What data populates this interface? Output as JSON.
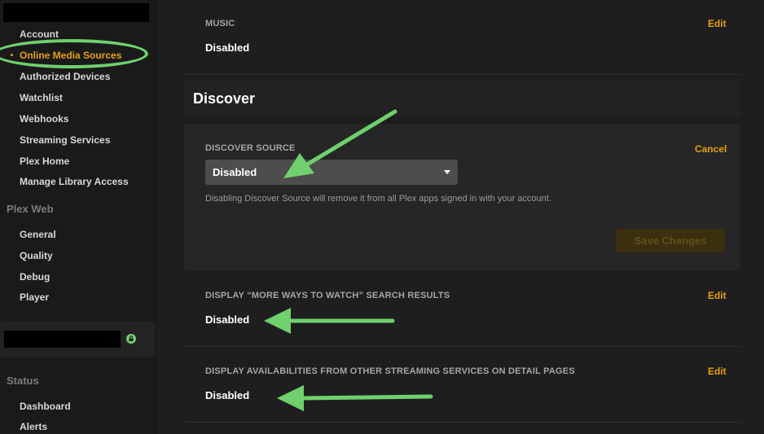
{
  "sidebar": {
    "account_items": [
      {
        "label": "Account"
      },
      {
        "label": "Online Media Sources"
      },
      {
        "label": "Authorized Devices"
      },
      {
        "label": "Watchlist"
      },
      {
        "label": "Webhooks"
      },
      {
        "label": "Streaming Services"
      },
      {
        "label": "Plex Home"
      },
      {
        "label": "Manage Library Access"
      }
    ],
    "plex_web_heading": "Plex Web",
    "plex_web_items": [
      {
        "label": "General"
      },
      {
        "label": "Quality"
      },
      {
        "label": "Debug"
      },
      {
        "label": "Player"
      }
    ],
    "status_heading": "Status",
    "status_items": [
      {
        "label": "Dashboard"
      },
      {
        "label": "Alerts"
      }
    ]
  },
  "main": {
    "music": {
      "label": "MUSIC",
      "value": "Disabled",
      "action": "Edit"
    },
    "discover": {
      "title": "Discover",
      "source_label": "DISCOVER SOURCE",
      "source_value": "Disabled",
      "cancel": "Cancel",
      "help": "Disabling Discover Source will remove it from all Plex apps signed in with your account.",
      "save": "Save Changes"
    },
    "more_ways": {
      "label": "DISPLAY “MORE WAYS TO WATCH” SEARCH RESULTS",
      "value": "Disabled",
      "action": "Edit"
    },
    "availabilities": {
      "label": "DISPLAY AVAILABILITIES FROM OTHER STREAMING SERVICES ON DETAIL PAGES",
      "value": "Disabled",
      "action": "Edit"
    }
  },
  "colors": {
    "accent": "#e5a00d",
    "annotation": "#6fd06d"
  }
}
